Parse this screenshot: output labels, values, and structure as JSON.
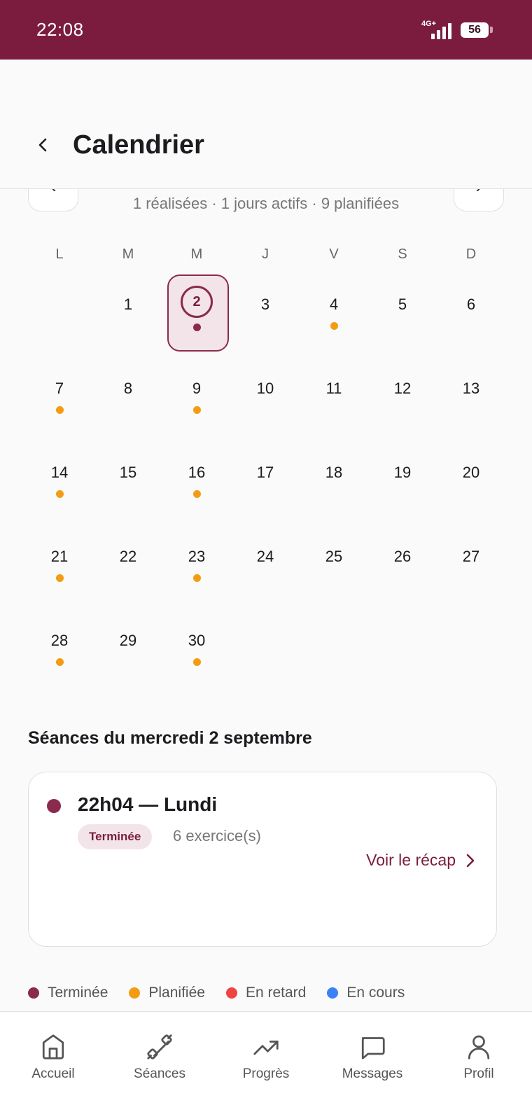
{
  "status_bar": {
    "time": "22:08",
    "network": "4G+",
    "battery": "56"
  },
  "header": {
    "title": "Calendrier"
  },
  "month_nav": {
    "prev_icon": "chevron-left-icon",
    "next_icon": "chevron-right-icon",
    "prev_glyph": "‹",
    "next_glyph": "›"
  },
  "summary": "1 réalisées · 1 jours actifs · 9 planifiées",
  "weekdays": [
    "L",
    "M",
    "M",
    "J",
    "V",
    "S",
    "D"
  ],
  "calendar": {
    "leading_blanks": 1,
    "selected_day": "2",
    "days": [
      {
        "n": "1",
        "status": ""
      },
      {
        "n": "2",
        "status": "done"
      },
      {
        "n": "3",
        "status": ""
      },
      {
        "n": "4",
        "status": "planned"
      },
      {
        "n": "5",
        "status": ""
      },
      {
        "n": "6",
        "status": ""
      },
      {
        "n": "7",
        "status": "planned"
      },
      {
        "n": "8",
        "status": ""
      },
      {
        "n": "9",
        "status": "planned"
      },
      {
        "n": "10",
        "status": ""
      },
      {
        "n": "11",
        "status": ""
      },
      {
        "n": "12",
        "status": ""
      },
      {
        "n": "13",
        "status": ""
      },
      {
        "n": "14",
        "status": "planned"
      },
      {
        "n": "15",
        "status": ""
      },
      {
        "n": "16",
        "status": "planned"
      },
      {
        "n": "17",
        "status": ""
      },
      {
        "n": "18",
        "status": ""
      },
      {
        "n": "19",
        "status": ""
      },
      {
        "n": "20",
        "status": ""
      },
      {
        "n": "21",
        "status": "planned"
      },
      {
        "n": "22",
        "status": ""
      },
      {
        "n": "23",
        "status": "planned"
      },
      {
        "n": "24",
        "status": ""
      },
      {
        "n": "25",
        "status": ""
      },
      {
        "n": "26",
        "status": ""
      },
      {
        "n": "27",
        "status": ""
      },
      {
        "n": "28",
        "status": "planned"
      },
      {
        "n": "29",
        "status": ""
      },
      {
        "n": "30",
        "status": "planned"
      }
    ]
  },
  "sessions": {
    "title": "Séances du mercredi 2 septembre",
    "items": [
      {
        "title": "22h04 — Lundi",
        "badge": "Terminée",
        "subtitle": "6 exercice(s)",
        "link": "Voir le récap",
        "link_glyph": "›"
      }
    ]
  },
  "legend": [
    {
      "label": "Terminée",
      "color": "#8a2a4c"
    },
    {
      "label": "Planifiée",
      "color": "#f39c12"
    },
    {
      "label": "En retard",
      "color": "#ef4444"
    },
    {
      "label": "En cours",
      "color": "#3b82f6"
    }
  ],
  "bottom_nav": [
    {
      "label": "Accueil",
      "icon": "home-icon"
    },
    {
      "label": "Séances",
      "icon": "dumbbell-icon"
    },
    {
      "label": "Progrès",
      "icon": "trending-up-icon"
    },
    {
      "label": "Messages",
      "icon": "message-icon"
    },
    {
      "label": "Profil",
      "icon": "user-icon"
    }
  ],
  "colors": {
    "brand": "#7b1c3e",
    "done": "#8a2a4c",
    "planned": "#f39c12",
    "late": "#ef4444",
    "in_progress": "#3b82f6"
  }
}
